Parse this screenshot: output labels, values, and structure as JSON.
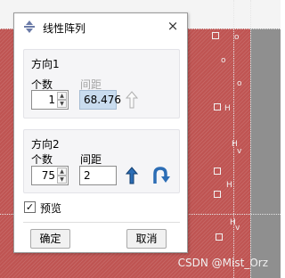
{
  "dialog": {
    "title": "线性阵列",
    "close_glyph": "×",
    "title_icon": "linear-pattern-icon",
    "direction1": {
      "title": "方向1",
      "count_label": "个数",
      "count_value": "1",
      "spacing_label": "间距",
      "spacing_value": "68.476",
      "direction_icon": "up-arrow-outline-icon"
    },
    "direction2": {
      "title": "方向2",
      "count_label": "个数",
      "count_value": "75",
      "spacing_label": "间距",
      "spacing_value": "2",
      "direction_icon": "up-arrow-blue-icon",
      "reverse_icon": "reverse-arrow-blue-icon"
    },
    "preview": {
      "label": "预览",
      "checked": true,
      "check_glyph": "✓"
    },
    "ok_label": "确定",
    "cancel_label": "取消"
  },
  "background": {
    "watermark": "CSDN @Mist_Orz",
    "scatter_labels": [
      "o",
      "o",
      "o",
      "o",
      "H",
      "H",
      "H",
      "H",
      "v",
      "v"
    ],
    "colors": {
      "red": "#bf5452",
      "grey": "#8f8f8f"
    }
  }
}
